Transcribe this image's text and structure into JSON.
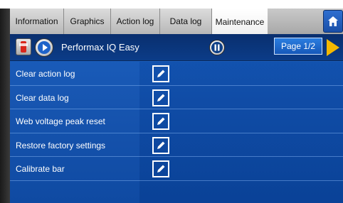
{
  "tabs": [
    {
      "label": "Information",
      "active": false
    },
    {
      "label": "Graphics",
      "active": false
    },
    {
      "label": "Action log",
      "active": false
    },
    {
      "label": "Data log",
      "active": false
    },
    {
      "label": "Maintenance",
      "active": true
    }
  ],
  "header": {
    "title": "Performax IQ Easy",
    "page_label": "Page 1/2",
    "icons": [
      "app-icon",
      "play-icon",
      "pause-icon",
      "next-arrow-icon",
      "home-icon"
    ]
  },
  "rows": [
    {
      "label": "Clear action log",
      "icon": "edit-icon"
    },
    {
      "label": "Clear data log",
      "icon": "edit-icon"
    },
    {
      "label": "Web voltage peak reset",
      "icon": "edit-icon"
    },
    {
      "label": "Restore factory settings",
      "icon": "edit-icon"
    },
    {
      "label": "Calibrate bar",
      "icon": "edit-icon"
    }
  ],
  "colors": {
    "panel_blue": "#1755b0",
    "header_blue": "#0b3c88",
    "accent_yellow": "#f4b800"
  }
}
